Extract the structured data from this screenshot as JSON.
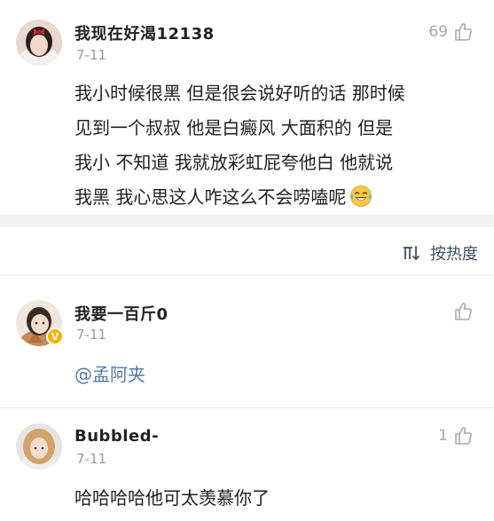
{
  "comments": [
    {
      "username": "我现在好渴12138",
      "date": "7-11",
      "likes": "69",
      "lines": [
        "我小时候很黑 但是很会说好听的话 那时候",
        "见到一个叔叔 他是白癜风 大面积的 但是",
        "我小 不知道 我就放彩虹屁夸他白 他就说",
        "我黑 我心思这人咋这么不会唠嗑呢"
      ],
      "emoji": "laughing-tears"
    },
    {
      "username": "我要一百斤0",
      "date": "7-11",
      "likes": "",
      "mention": "@孟阿夹",
      "verified": "V"
    },
    {
      "username": "Bubbled-",
      "date": "7-11",
      "likes": "1",
      "text": "哈哈哈哈他可太羡慕你了"
    }
  ],
  "sort": {
    "label": "按热度",
    "icon": "sort-icon"
  },
  "colors": {
    "link": "#5177a6",
    "muted": "#9a9a9a",
    "divider": "#f2f2f2"
  }
}
